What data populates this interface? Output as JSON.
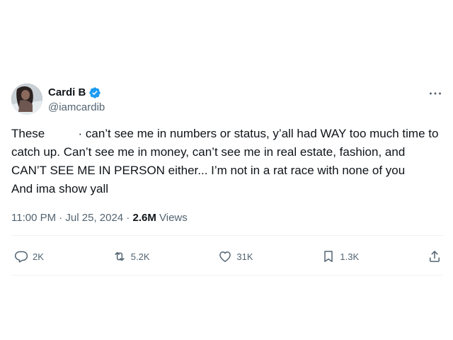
{
  "tweet": {
    "display_name": "Cardi B",
    "handle": "@iamcardib",
    "text": "These          · can’t see me in numbers or status, y’all had WAY too much time to catch up. Can’t see me in money, can’t see me in real estate, fashion, and CAN’T SEE ME IN PERSON either... I’m not in a rat race with none of you                And ima show yall",
    "timestamp": "11:00 PM · Jul 25, 2024 · ",
    "views_count": "2.6M",
    "views_label": " Views"
  },
  "actions": {
    "reply_count": "2K",
    "retweet_count": "5.2K",
    "like_count": "31K",
    "bookmark_count": "1.3K"
  },
  "icons": {
    "verified": "verified-badge-icon",
    "more": "more-icon",
    "reply": "reply-icon",
    "retweet": "retweet-icon",
    "like": "like-icon",
    "bookmark": "bookmark-icon",
    "share": "share-icon"
  },
  "colors": {
    "verified": "#1d9bf0",
    "secondary_text": "#536471",
    "primary_text": "#0f1419"
  }
}
